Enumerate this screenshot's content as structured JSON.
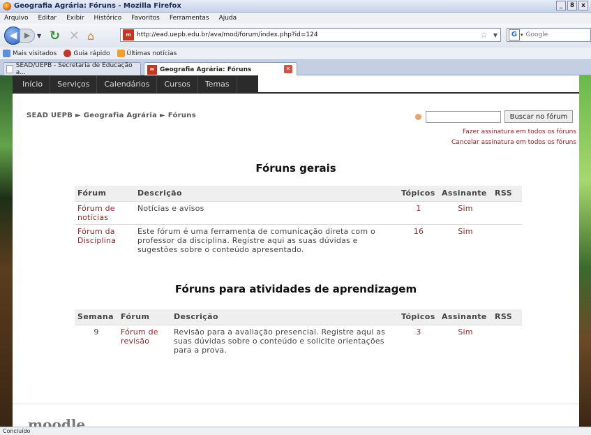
{
  "window": {
    "title": "Geografia Agrária: Fóruns - Mozilla Firefox",
    "controls": [
      "_",
      "8",
      "x"
    ]
  },
  "menubar": [
    "Arquivo",
    "Editar",
    "Exibir",
    "Histórico",
    "Favoritos",
    "Ferramentas",
    "Ajuda"
  ],
  "navigation": {
    "url": "http://ead.uepb.edu.br/ava/mod/forum/index.php?id=124",
    "search_engine_letter": "G",
    "search_placeholder": "Google"
  },
  "bookmarks": [
    "Mais visitados",
    "Guia rápido",
    "Últimas notícias"
  ],
  "tabs": [
    {
      "label": "SEAD/UEPB - Secretaria de Educação a...",
      "active": false
    },
    {
      "label": "Geografia Agrária: Fóruns",
      "active": true
    }
  ],
  "page": {
    "topnav": [
      "Início",
      "Serviços",
      "Calendários",
      "Cursos",
      "Temas"
    ],
    "breadcrumb": "SEAD UEPB ► Geografia Agrária ► Fóruns",
    "search": {
      "button": "Buscar no fórum",
      "value": ""
    },
    "subscribe_all": "Fazer assinatura em todos os fóruns",
    "unsubscribe_all": "Cancelar assinatura em todos os fóruns",
    "general": {
      "heading": "Fóruns gerais",
      "headers": [
        "Fórum",
        "Descrição",
        "Tópicos",
        "Assinante",
        "RSS"
      ],
      "rows": [
        {
          "forum": "Fórum de notícias",
          "desc": "Notícias e avisos",
          "topics": "1",
          "sub": "Sim",
          "rss": ""
        },
        {
          "forum": "Fórum da Disciplina",
          "desc": "Este fórum é uma ferramenta de comunicação direta com o professor da disciplina. Registre aqui as suas dúvidas e sugestões sobre o conteúdo apresentado.",
          "topics": "16",
          "sub": "Sim",
          "rss": ""
        }
      ]
    },
    "learning": {
      "heading": "Fóruns para atividades de aprendizagem",
      "headers": [
        "Semana",
        "Fórum",
        "Descrição",
        "Tópicos",
        "Assinante",
        "RSS"
      ],
      "rows": [
        {
          "week": "9",
          "forum": "Fórum de revisão",
          "desc": "Revisão para a avaliação presencial. Registre aqui as suas dúvidas sobre o conteúdo e solicite orientações para a prova.",
          "topics": "3",
          "sub": "Sim",
          "rss": ""
        }
      ]
    },
    "footer_logo": "moodle"
  },
  "status": "Concluído"
}
